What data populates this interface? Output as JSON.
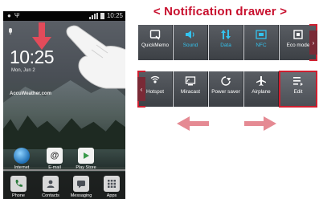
{
  "heading": "< Notification drawer >",
  "phone": {
    "status_time": "10:25",
    "clock": "10:25",
    "date": "Mon, Jun 2",
    "weather_brand": "AccuWeather.com",
    "apps": [
      {
        "label": "Internet",
        "icon": "globe-icon"
      },
      {
        "label": "E-mail",
        "icon": "at-sign-icon"
      },
      {
        "label": "Play Store",
        "icon": "play-store-icon"
      }
    ],
    "dock": [
      {
        "label": "Phone",
        "icon": "phone-icon"
      },
      {
        "label": "Contacts",
        "icon": "contacts-icon"
      },
      {
        "label": "Messaging",
        "icon": "messaging-icon"
      },
      {
        "label": "Apps",
        "icon": "apps-grid-icon"
      }
    ]
  },
  "tray_top": [
    {
      "label": "QuickMemo",
      "icon": "quickmemo-icon",
      "on": false
    },
    {
      "label": "Sound",
      "icon": "speaker-icon",
      "on": true
    },
    {
      "label": "Data",
      "icon": "data-arrows-icon",
      "on": true
    },
    {
      "label": "NFC",
      "icon": "nfc-icon",
      "on": true
    },
    {
      "label": "Eco mode",
      "icon": "eco-mode-icon",
      "on": false
    }
  ],
  "tray_bottom": [
    {
      "label": "Hotspot",
      "icon": "hotspot-icon",
      "on": false
    },
    {
      "label": "Miracast",
      "icon": "miracast-icon",
      "on": false
    },
    {
      "label": "Power saver",
      "icon": "power-saver-icon",
      "on": false
    },
    {
      "label": "Airplane",
      "icon": "airplane-icon",
      "on": false
    },
    {
      "label": "Edit",
      "icon": "edit-list-icon",
      "on": false
    }
  ],
  "colors": {
    "accent_red": "#cf1e2f",
    "heading_red": "#c8102e",
    "tile_on_blue": "#33c3ef",
    "arrow_pink": "#e58a93"
  }
}
